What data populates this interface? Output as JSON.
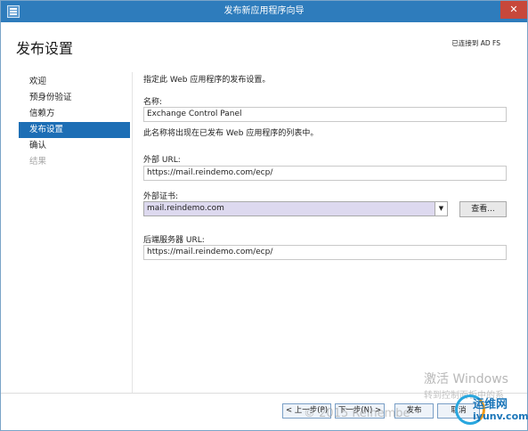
{
  "window": {
    "title": "发布新应用程序向导",
    "close_glyph": "✕"
  },
  "header": {
    "page_title": "发布设置",
    "connected_to": "已连接到 AD FS"
  },
  "nav": {
    "items": [
      {
        "label": "欢迎",
        "state": "normal"
      },
      {
        "label": "预身份验证",
        "state": "normal"
      },
      {
        "label": "信赖方",
        "state": "normal"
      },
      {
        "label": "发布设置",
        "state": "active"
      },
      {
        "label": "确认",
        "state": "normal"
      },
      {
        "label": "结果",
        "state": "disabled"
      }
    ]
  },
  "form": {
    "intro": "指定此 Web 应用程序的发布设置。",
    "name_label": "名称:",
    "name_value": "Exchange Control Panel",
    "name_hint": "此名称将出现在已发布 Web 应用程序的列表中。",
    "external_url_label": "外部 URL:",
    "external_url_value": "https://mail.reindemo.com/ecp/",
    "cert_label": "外部证书:",
    "cert_value": "mail.reindemo.com",
    "view_button": "查看...",
    "backend_url_label": "后端服务器 URL:",
    "backend_url_value": "https://mail.reindemo.com/ecp/"
  },
  "footer": {
    "back": "< 上一步(P)",
    "next": "下一步(N) >",
    "publish": "发布",
    "cancel": "取消"
  },
  "overlay": {
    "activate_windows": "激活 Windows",
    "activate_hint": "转到控制面板中的系",
    "copyright": "© 2015 Reinembe",
    "logo_line1": "运维网",
    "logo_line2": "iyunv.com"
  },
  "colors": {
    "title_bar": "#2e7cbc",
    "nav_active": "#1d6eb5",
    "close_button": "#c7483b",
    "cert_select_bg": "#ddd9ef"
  }
}
